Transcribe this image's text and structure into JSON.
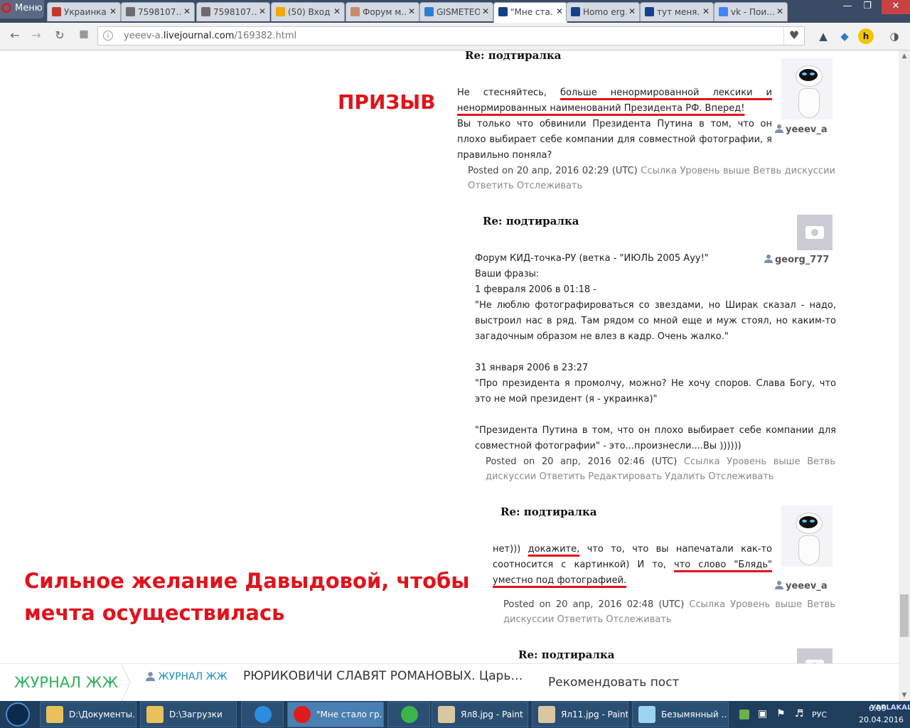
{
  "browser": {
    "menu_label": "Меню",
    "tabs": [
      {
        "title": "Украинка",
        "color": "#c0392b"
      },
      {
        "title": "7598107…",
        "color": "#6c6c6c"
      },
      {
        "title": "7598107…",
        "color": "#6c6c6c"
      },
      {
        "title": "(50) Вход",
        "color": "#f1a80a"
      },
      {
        "title": "Форум м…",
        "color": "#c98b6b"
      },
      {
        "title": "GISMETEO",
        "color": "#2f7fd0"
      },
      {
        "title": "\"Мне ста…",
        "color": "#15418a"
      },
      {
        "title": "Homo erg…",
        "color": "#15418a"
      },
      {
        "title": "тут меня…",
        "color": "#15418a"
      },
      {
        "title": "vk - Пои…",
        "color": "#4285f4"
      }
    ],
    "url_prefix": "yeeev-a.",
    "url_domain": "livejournal.com",
    "url_path": "/169382.html"
  },
  "annotations": {
    "call_label": "ПРИЗЫВ",
    "wish_line1": "Сильное желание Давыдовой, чтобы",
    "wish_line2": "мечта осуществилась"
  },
  "comments": [
    {
      "title": "Re: подтиралка",
      "user": "yeeev_a",
      "avatar": "eve-robot",
      "p1_a": "Не стесняйтесь, ",
      "p1_b": "больше ненормированной лексики и",
      "p1_c": "ненормированных наименований Президента РФ. Вперед!",
      "p2": "Вы только что обвинили Президента Путина в том, что он плохо выбирает себе компании для совместной фотографии, я правильно поняла?",
      "posted": "Posted on 20 апр, 2016 02:29 (UTC)",
      "links": "Ссылка Уровень выше Ветвь дискуссии Ответить Отслеживать"
    },
    {
      "title": "Re: подтиралка",
      "user": "georg_777",
      "avatar": "camera",
      "l1": "Форум КИД-точка-РУ (ветка - \"ИЮЛЬ 2005 Ауу!\"",
      "l2": "Ваши фразы:",
      "l3": "1 февраля 2006 в 01:18 -",
      "l4": "\"Не люблю фотографироваться со звездами, но Ширак сказал - надо, выстроил нас в ряд. Там рядом со мной еще и муж стоял, но каким-то загадочным образом не влез в кадр. Очень жалко.\"",
      "l5": "31 января 2006 в 23:27",
      "l6": "\"Про президента я промолчу, можно? Не хочу споров. Слава Богу, что это не мой президент (я - украинка)\"",
      "l7": "\"Президента Путина в том, что он плохо выбирает себе компании для совместной фотографии\" - это...произнесли....Вы ))))))",
      "posted": "Posted on 20 апр, 2016 02:46 (UTC)",
      "links": "Ссылка Уровень выше Ветвь дискуссии Ответить Редактировать Удалить Отслеживать"
    },
    {
      "title": "Re: подтиралка",
      "user": "yeeev_a",
      "avatar": "eve-robot",
      "t1": "нет))) ",
      "t2": "докажите,",
      "t3": " что то, что вы напечатали как-то соотносится с картинкой) И то, ",
      "t4": "что слово \"Блядь\"",
      "t5": " ",
      "t6": "уместно под фотографией.",
      "posted": "Posted on 20 апр, 2016 02:48 (UTC)",
      "links": "Ссылка Уровень выше Ветвь дискуссии Ответить Отслеживать"
    },
    {
      "title": "Re: подтиралка",
      "avatar": "camera"
    }
  ],
  "lj_bar": {
    "brand": "ЖУРНАЛ ЖЖ",
    "author": "ЖУРНАЛ ЖЖ",
    "headline": "РЮРИКОВИЧИ СЛАВЯТ РОМАНОВЫХ. Царь…",
    "recommend": "Рекомендовать пост"
  },
  "taskbar": {
    "items": [
      {
        "label": "D:\\Документы…",
        "icon": "folder-icon"
      },
      {
        "label": "D:\\Загрузки",
        "icon": "folder-icon"
      },
      {
        "label": "",
        "icon": "ie-icon"
      },
      {
        "label": "\"Мне стало гр…",
        "icon": "opera-icon"
      },
      {
        "label": "",
        "icon": "mail-at-icon"
      },
      {
        "label": "Ял8.jpg - Paint",
        "icon": "paint-icon"
      },
      {
        "label": "Ял11.jpg - Paint",
        "icon": "paint-icon"
      },
      {
        "label": "Безымянный …",
        "icon": "notepad-icon"
      }
    ],
    "lang": "РУС",
    "time": "6:09",
    "date": "20.04.2016",
    "watermark": "YAPLAKAL.COM"
  }
}
